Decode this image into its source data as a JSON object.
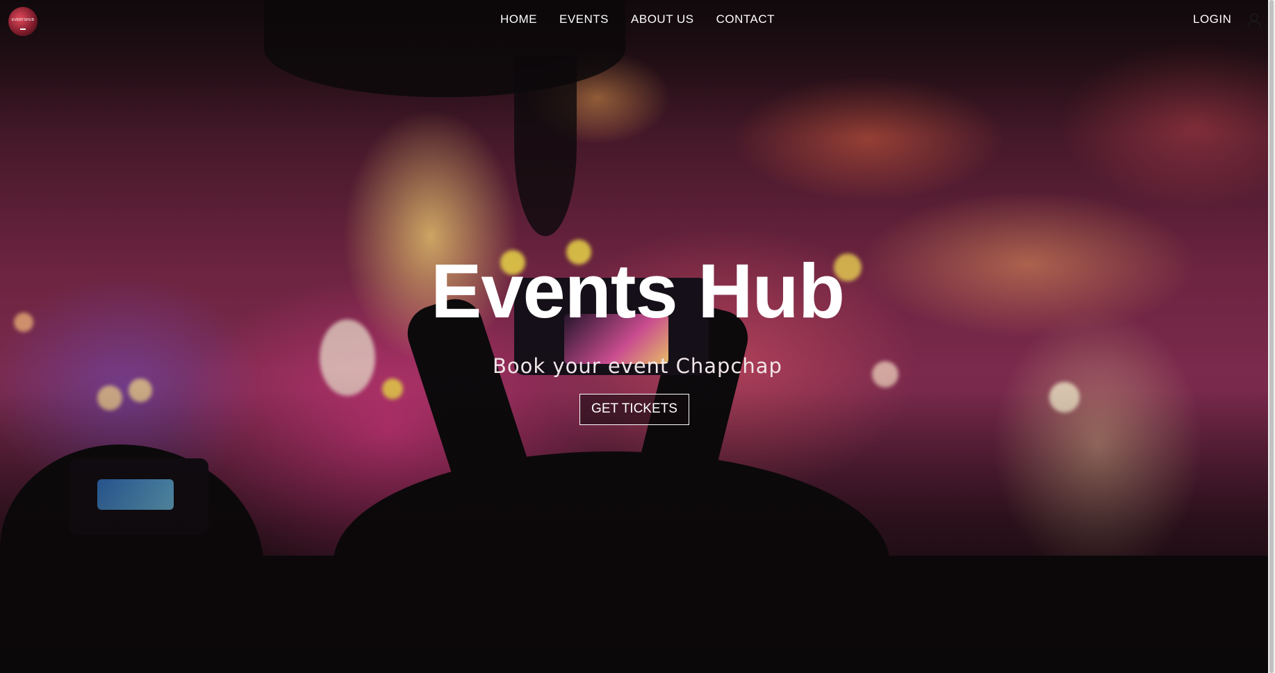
{
  "navbar": {
    "logo_text": "EVENTSHUB",
    "links": [
      {
        "label": "HOME"
      },
      {
        "label": "EVENTS"
      },
      {
        "label": "ABOUT US"
      },
      {
        "label": "CONTACT"
      }
    ],
    "login_label": "LOGIN",
    "user_icon": "user-icon"
  },
  "hero": {
    "title": "Events Hub",
    "subtitle": "Book your event Chapchap",
    "cta_label": "GET TICKETS"
  },
  "colors": {
    "text": "#ffffff",
    "background": "#141012",
    "accent_pink": "#8a2f56",
    "accent_orange": "#ff9650"
  }
}
